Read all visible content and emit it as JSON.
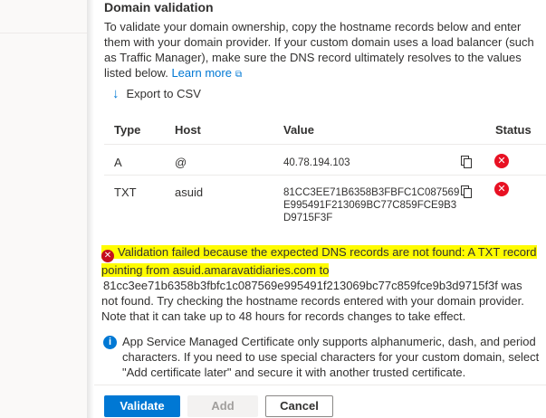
{
  "panel": {
    "title": "Domain validation",
    "description": "To validate your domain ownership, copy the hostname records below and enter them with your domain provider. If your custom domain uses a load balancer (such as Traffic Manager), make sure the DNS record ultimately resolves to the values listed below.",
    "learn_more": "Learn more",
    "export_label": "Export to CSV"
  },
  "table": {
    "headers": {
      "type": "Type",
      "host": "Host",
      "value": "Value",
      "status": "Status"
    },
    "rows": [
      {
        "type": "A",
        "host": "@",
        "value_lines": [
          "40.78.194.103",
          "",
          ""
        ],
        "status": "error"
      },
      {
        "type": "TXT",
        "host": "asuid",
        "value_lines": [
          "81CC3EE71B6358B3FBFC1C087569",
          "E995491F213069BC77C859FCE9B3",
          "D9715F3F"
        ],
        "status": "error"
      }
    ]
  },
  "warning": {
    "highlighted": "Validation failed because the expected DNS records are not found: A TXT record pointing from asuid.amaravatidiaries.com to",
    "rest": "81cc3ee71b6358b3fbfc1c087569e995491f213069bc77c859fce9b3d9715f3f was not found. Try checking the hostname records entered with your domain provider. Note that it can take up to 48 hours for records changes to take effect."
  },
  "info": {
    "text": "App Service Managed Certificate only supports alphanumeric, dash, and period characters. If you need to use special characters for your custom domain, select \"Add certificate later\" and secure it with another trusted certificate."
  },
  "buttons": {
    "validate": "Validate",
    "add": "Add",
    "cancel": "Cancel"
  },
  "colors": {
    "accent": "#0078d4",
    "error": "#e81123",
    "highlight": "#fffc00"
  }
}
